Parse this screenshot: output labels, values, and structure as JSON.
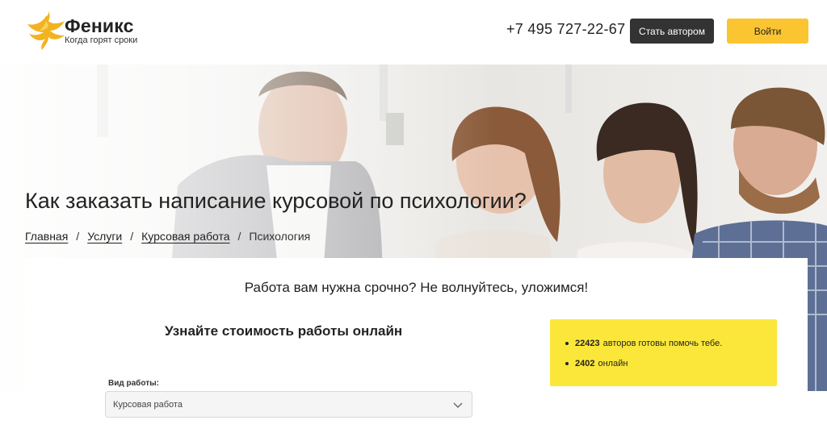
{
  "header": {
    "logo_title": "Феникс",
    "logo_subtitle": "Когда горят сроки",
    "phone": "+7 495 727-22-67",
    "author_button": "Стать автором",
    "login_button": "Войти"
  },
  "hero": {
    "title": "Как заказать написание курсовой по психологии?",
    "breadcrumbs": [
      {
        "label": "Главная"
      },
      {
        "label": "Услуги"
      },
      {
        "label": "Курсовая работа"
      },
      {
        "label": "Психология"
      }
    ]
  },
  "card": {
    "headline": "Работа вам нужна срочно? Не волнуйтесь, уложимся!",
    "calc_title": "Узнайте стоимость работы онлайн",
    "work_type_label": "Вид работы:",
    "work_type_value": "Курсовая работа",
    "stats": [
      {
        "value": "22423",
        "text": "авторов готовы помочь тебе."
      },
      {
        "value": "2402",
        "text": "онлайн"
      }
    ]
  },
  "colors": {
    "accent_yellow": "#fbc531",
    "info_yellow": "#fbe73a",
    "dark_button": "#333333"
  }
}
